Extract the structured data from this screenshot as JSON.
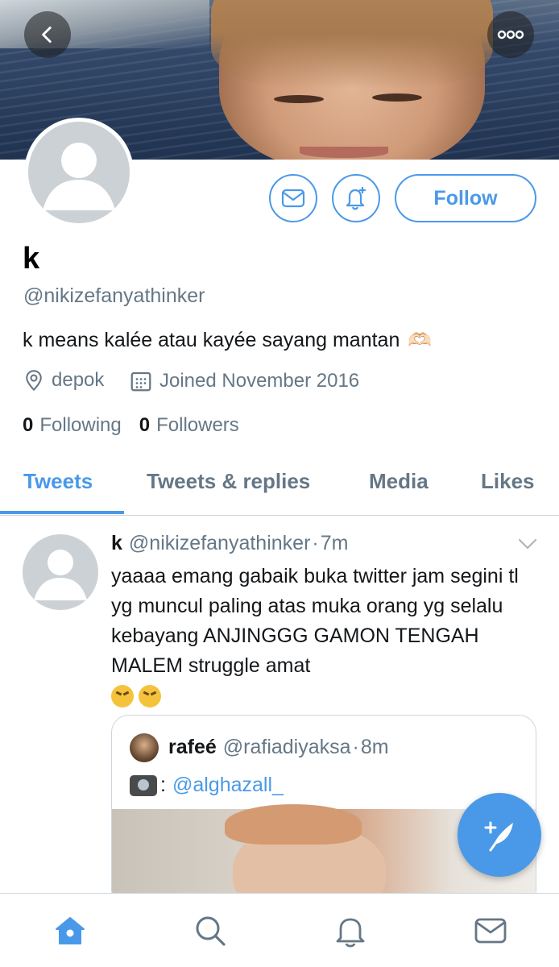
{
  "header": {
    "back_icon": "chevron-left-icon",
    "more_icon": "more-horizontal-icon"
  },
  "profile": {
    "name": "k",
    "handle": "@nikizefanyathinker",
    "bio": "k means kalée atau kayée sayang mantan",
    "bio_emoji": "🫶🏻",
    "location": "depok",
    "joined": "Joined November 2016",
    "following_count": "0",
    "following_label": "Following",
    "followers_count": "0",
    "followers_label": "Followers"
  },
  "actions": {
    "follow_label": "Follow",
    "message_icon": "mail-icon",
    "notify_icon": "bell-plus-icon"
  },
  "tabs": [
    {
      "label": "Tweets",
      "active": true
    },
    {
      "label": "Tweets & replies",
      "active": false
    },
    {
      "label": "Media",
      "active": false
    },
    {
      "label": "Likes",
      "active": false
    }
  ],
  "tweet": {
    "name": "k",
    "handle": "@nikizefanyathinker",
    "separator": "·",
    "time": "7m",
    "text": "yaaaa emang gabaik buka twitter jam segini tl yg muncul paling atas muka orang yg selalu kebayang ANJINGGG GAMON TENGAH MALEM struggle amat",
    "quote": {
      "name": "rafeé",
      "handle": "@rafiadiyaksa",
      "separator": "·",
      "time": "8m",
      "text_prefix": ":",
      "mention": "@alghazall_"
    }
  },
  "colors": {
    "accent": "#4a99e9",
    "secondary_text": "#657786",
    "primary_text": "#14171a",
    "border": "#ccd6dd"
  },
  "bottom_nav": [
    {
      "icon": "home-icon",
      "active": true
    },
    {
      "icon": "search-icon",
      "active": false
    },
    {
      "icon": "notifications-bell-icon",
      "active": false
    },
    {
      "icon": "messages-mail-icon",
      "active": false
    }
  ]
}
